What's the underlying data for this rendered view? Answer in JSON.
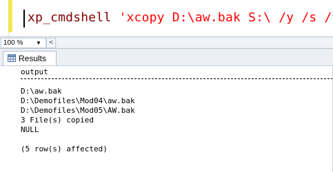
{
  "editor": {
    "query_keyword": "xp_cmdshell",
    "query_string": "'xcopy D:\\aw.bak S:\\ /y /s /v'"
  },
  "zoom": {
    "value": "100 %",
    "dropdown_icon": "chevron-down-icon",
    "scroll_left_icon": "chevron-left-icon"
  },
  "tabs": [
    {
      "label": "Results",
      "icon": "grid-icon"
    }
  ],
  "results": {
    "column_header": "output",
    "rows": [
      "D:\\aw.bak",
      "D:\\Demofiles\\Mod04\\aw.bak",
      "D:\\Demofiles\\Mod05\\AW.bak",
      "3 File(s) copied",
      "NULL"
    ],
    "footer": "(5 row(s) affected)"
  },
  "colors": {
    "keyword": "#800000",
    "string": "#ff0000",
    "change_marker": "#f2e64c"
  }
}
